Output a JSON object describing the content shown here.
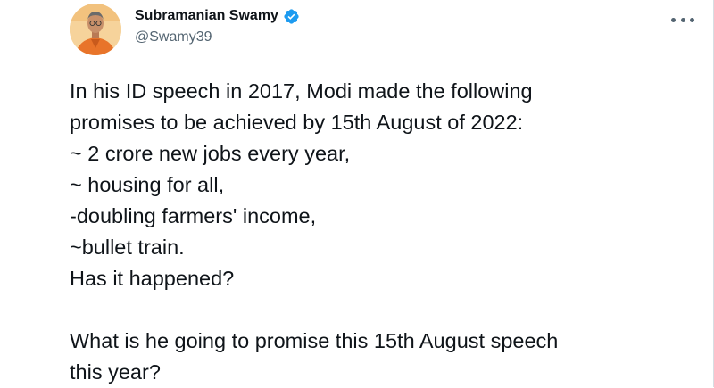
{
  "tweet": {
    "author": {
      "name": "Subramanian Swamy",
      "handle": "@Swamy39",
      "avatar_icon": "profile-photo",
      "verified_icon": "verified-badge-icon",
      "verified_color": "#1d9bf0"
    },
    "more_icon": "more-options-icon",
    "lines": [
      "In his ID speech in 2017, Modi made the following",
      "promises to be achieved by 15th August of 2022:",
      "~ 2 crore new jobs every year,",
      "~ housing for all,",
      "-doubling farmers' income,",
      "~bullet train.",
      "Has it happened?",
      "",
      "What is he going to promise this 15th August speech",
      "this year?"
    ]
  }
}
